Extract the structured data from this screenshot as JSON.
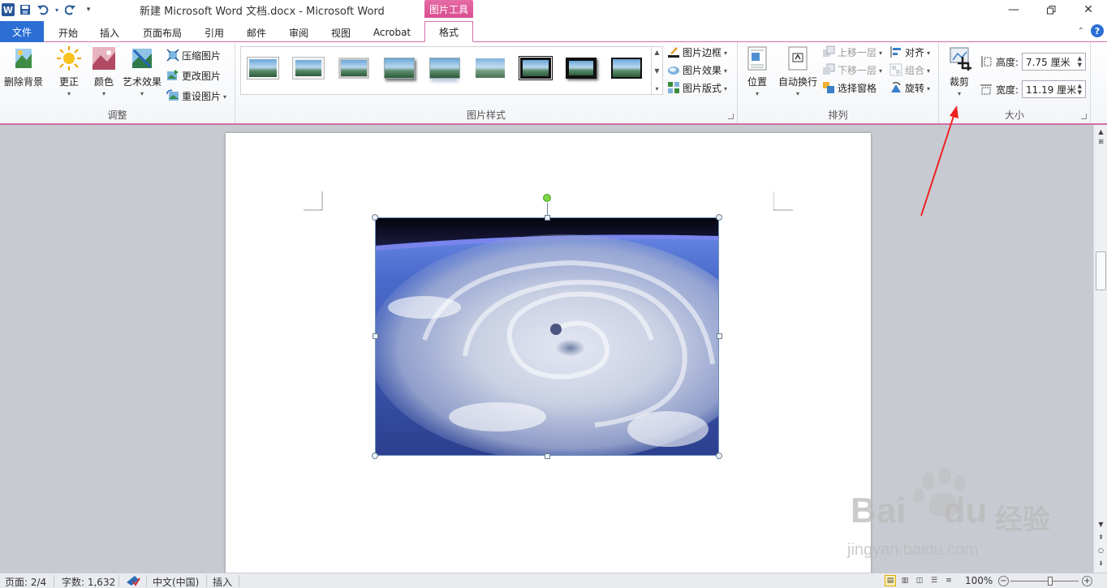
{
  "app": {
    "title": "新建 Microsoft Word 文档.docx  -  Microsoft Word",
    "context_group": "图片工具"
  },
  "qat": {
    "icons": [
      "word-logo-icon",
      "save-icon",
      "undo-icon",
      "redo-icon",
      "customize-icon"
    ],
    "word_logo": "W"
  },
  "tabs": [
    {
      "label": "文件"
    },
    {
      "label": "开始"
    },
    {
      "label": "插入"
    },
    {
      "label": "页面布局"
    },
    {
      "label": "引用"
    },
    {
      "label": "邮件"
    },
    {
      "label": "审阅"
    },
    {
      "label": "视图"
    },
    {
      "label": "Acrobat"
    },
    {
      "label": "格式",
      "active": true
    }
  ],
  "ribbon": {
    "adjust": {
      "label": "调整",
      "remove_bg": "删除背景",
      "corrections": "更正",
      "color": "颜色",
      "artistic": "艺术效果",
      "compress": "压缩图片",
      "change": "更改图片",
      "reset": "重设图片"
    },
    "styles": {
      "label": "图片样式",
      "border": "图片边框",
      "effects": "图片效果",
      "layout": "图片版式"
    },
    "arrange": {
      "label": "排列",
      "position": "位置",
      "wrap": "自动换行",
      "bring_forward": "上移一层",
      "send_backward": "下移一层",
      "selection_pane": "选择窗格",
      "align": "对齐",
      "group": "组合",
      "rotate": "旋转"
    },
    "size": {
      "label": "大小",
      "crop": "裁剪",
      "height_label": "高度:",
      "height_value": "7.75 厘米",
      "width_label": "宽度:",
      "width_value": "11.19 厘米"
    }
  },
  "statusbar": {
    "page": "页面: 2/4",
    "words": "字数: 1,632",
    "language": "中文(中国)",
    "mode": "插入",
    "zoom": "100%"
  },
  "watermark": {
    "brand": "Bai",
    "brand2": "du",
    "cn": "经验",
    "url": "jingyan.baidu.com"
  },
  "colors": {
    "accent": "#2b6fd4",
    "context": "#d94f8f",
    "annotation_arrow": "#ee2222"
  }
}
